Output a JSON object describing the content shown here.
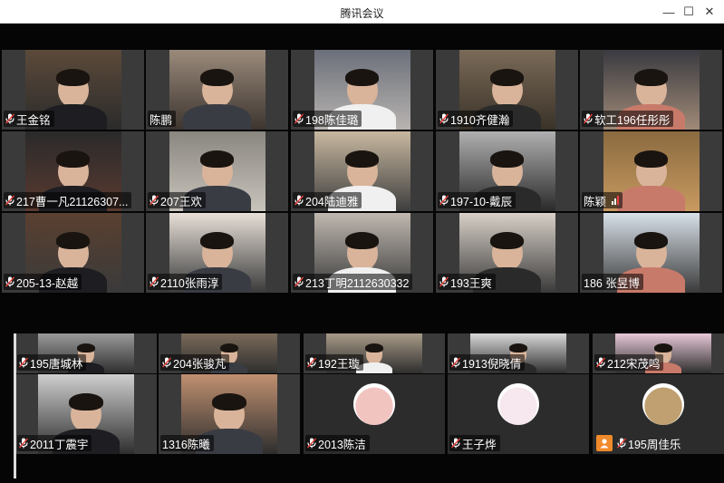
{
  "window": {
    "title": "腾讯会议"
  },
  "controls": {
    "minimize": "—",
    "maximize": "☐",
    "close": "✕"
  },
  "participants_row1": [
    {
      "name": "王金铭",
      "mic": "on"
    },
    {
      "name": "陈鹏",
      "mic": "none"
    },
    {
      "name": "198陈佳璐",
      "mic": "on"
    },
    {
      "name": "1910齐健瀚",
      "mic": "on"
    },
    {
      "name": "软工196任彤彤",
      "mic": "on"
    }
  ],
  "participants_row2": [
    {
      "name": "217曹一凡21126307...",
      "mic": "on"
    },
    {
      "name": "207王欢",
      "mic": "on"
    },
    {
      "name": "204陆迪雅",
      "mic": "on"
    },
    {
      "name": "197-10-戴辰",
      "mic": "on"
    },
    {
      "name": "陈颖",
      "mic": "none",
      "signal": true
    }
  ],
  "participants_row3": [
    {
      "name": "205-13-赵越",
      "mic": "on"
    },
    {
      "name": "2110张雨淳",
      "mic": "on"
    },
    {
      "name": "213丁明2112630332",
      "mic": "on"
    },
    {
      "name": "193王爽",
      "mic": "on"
    },
    {
      "name": "186 张昱博",
      "mic": "none"
    }
  ],
  "participants_row4": [
    {
      "name": "195唐城林",
      "mic": "on"
    },
    {
      "name": "204张骏芃",
      "mic": "on"
    },
    {
      "name": "192王璇",
      "mic": "on"
    },
    {
      "name": "1913倪晓倩",
      "mic": "on"
    },
    {
      "name": "212宋茂鸣",
      "mic": "on"
    }
  ],
  "participants_row5": [
    {
      "name": "2011丁震宇",
      "mic": "on"
    },
    {
      "name": "1316陈曦",
      "mic": "none"
    },
    {
      "name": "2013陈洁",
      "mic": "on"
    },
    {
      "name": "王子烨",
      "mic": "on"
    },
    {
      "name": "195周佳乐",
      "mic": "on",
      "badge": true
    }
  ],
  "colors": {
    "label_bg": "#00000088",
    "accent_orange": "#f08a2a",
    "signal_red": "#e8403a"
  }
}
